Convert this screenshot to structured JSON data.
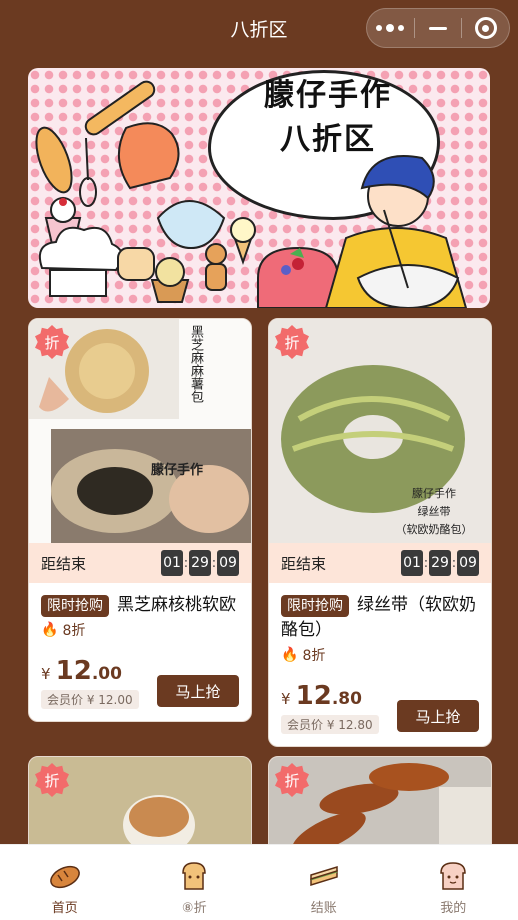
{
  "header": {
    "title": "八折区"
  },
  "banner": {
    "line1": "朦仔手作",
    "line2": "八折区"
  },
  "labels": {
    "countdown": "距结束",
    "flash_tag": "限时抢购",
    "buy": "马上抢",
    "discount_badge": "折",
    "currency": "¥"
  },
  "products": [
    {
      "name": "黑芝麻核桃软欧",
      "discount": "8折",
      "price_int": "12",
      "price_dec": ".00",
      "member_price": "会员价 ¥ 12.00",
      "countdown": [
        "01",
        "29",
        "09"
      ],
      "photo_caption": "黑芝麻麻薯包",
      "photo_brand": "朦仔手作"
    },
    {
      "name": "绿丝带（软欧奶酪包）",
      "discount": "8折",
      "price_int": "12",
      "price_dec": ".80",
      "member_price": "会员价 ¥ 12.80",
      "countdown": [
        "01",
        "29",
        "09"
      ],
      "photo_caption": "朦仔手作\n绿丝带\n（软欧奶酪包）"
    },
    {
      "name": "",
      "discount_badge": "折"
    },
    {
      "name": "",
      "discount_badge": "折"
    }
  ],
  "tabs": [
    {
      "label": "首页",
      "icon": "bread-icon",
      "active": true
    },
    {
      "label": "⑧折",
      "icon": "toast-icon"
    },
    {
      "label": "结账",
      "icon": "sandwich-icon"
    },
    {
      "label": "我的",
      "icon": "bread-face-icon"
    }
  ],
  "colors": {
    "brand": "#6b3a21",
    "badge": "#f26b6b",
    "timer_bg": "#fde5d9"
  }
}
